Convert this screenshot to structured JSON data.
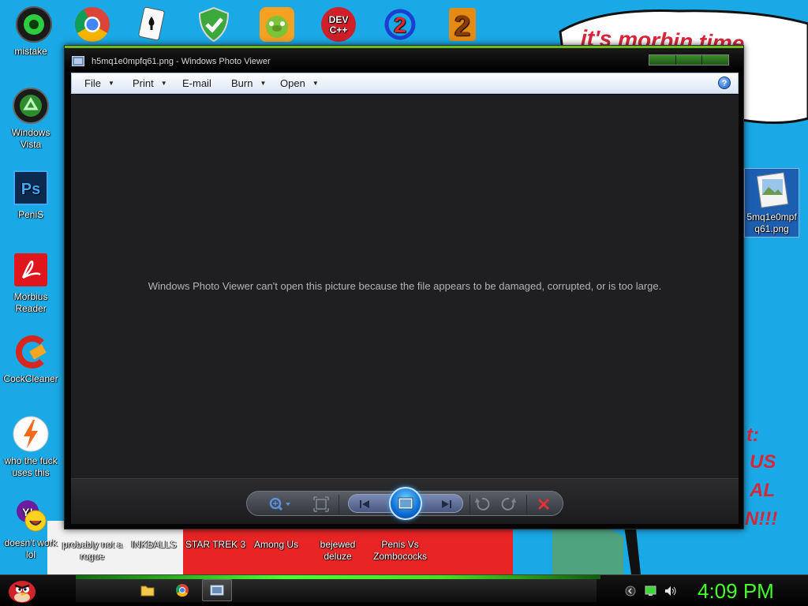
{
  "wallpaper": {
    "speech_bubble_text": "it's morbin time",
    "right_fragments": [
      "t:",
      "US",
      "AL",
      "N!!!"
    ]
  },
  "desktop_top_icons": [
    {
      "name": "green-ball-icon"
    },
    {
      "name": "chrome-icon"
    },
    {
      "name": "solitaire-icon"
    },
    {
      "name": "security-shield-icon"
    },
    {
      "name": "bad-piggies-icon"
    },
    {
      "name": "dev-cpp-icon",
      "label_glyph": "DEV C++"
    },
    {
      "name": "blue-2-icon",
      "label_glyph": "2"
    },
    {
      "name": "orange-2-icon",
      "label_glyph": "2"
    }
  ],
  "desktop_left_icons": [
    {
      "label": "mistake"
    },
    {
      "label": "Windows Vista"
    },
    {
      "label": "PeniS",
      "glyph": "Ps"
    },
    {
      "label": "Morbius Reader"
    },
    {
      "label": "CockCleaner"
    },
    {
      "label": "who the fuck uses this"
    },
    {
      "label": "doesn't work lol",
      "glyph": "Y!"
    }
  ],
  "desktop_bottom_icons": [
    {
      "label": "probably not a rogue"
    },
    {
      "label": "INKBALLS"
    },
    {
      "label": "STAR TREK 3"
    },
    {
      "label": "Among Us"
    },
    {
      "label": "bejewed deluze"
    },
    {
      "label": "Penis Vs Zombococks"
    }
  ],
  "desktop_right_icon": {
    "label": "5mq1e0mpfq61.png"
  },
  "window": {
    "title": "h5mq1e0mpfq61.png - Windows Photo Viewer",
    "menu": [
      "File",
      "Print",
      "E-mail",
      "Burn",
      "Open"
    ],
    "help_label": "?",
    "error_message": "Windows Photo Viewer can't open this picture because the file appears to be damaged, corrupted, or is too large."
  },
  "taskbar": {
    "clock": "4:09 PM"
  },
  "colors": {
    "desktop_blue": "#19a9e6",
    "accent_green": "#46ff2a",
    "viewer_bg": "#1f1f21"
  }
}
